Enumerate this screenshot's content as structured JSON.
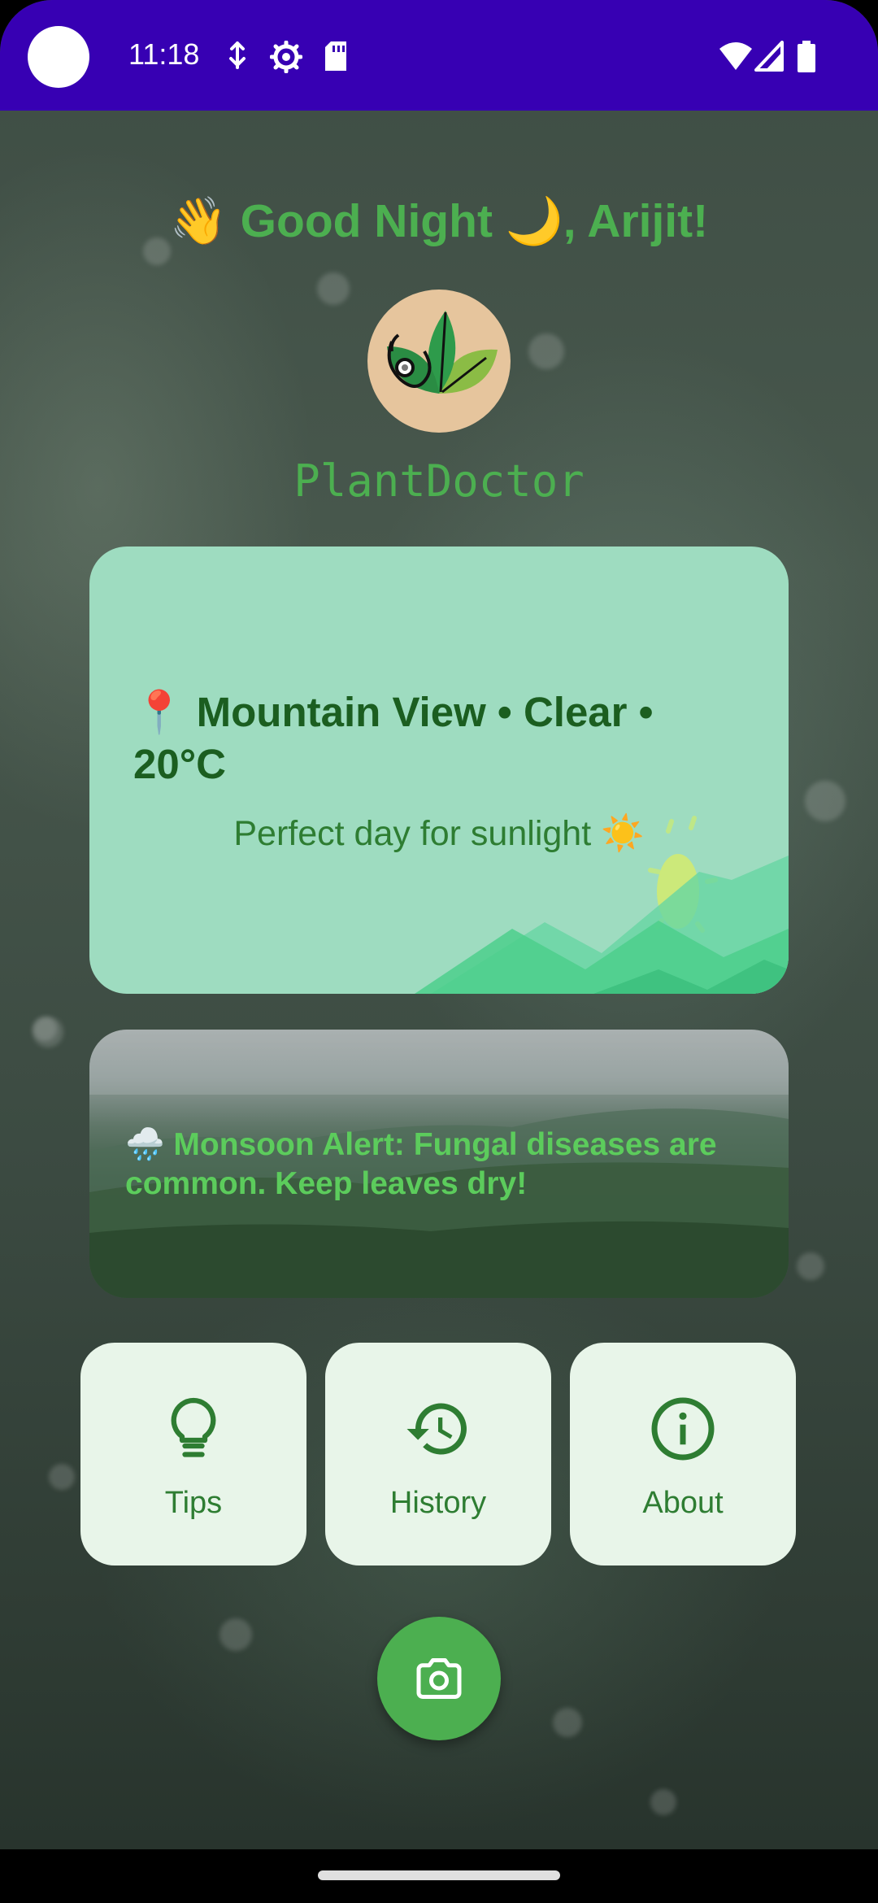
{
  "status_bar": {
    "time": "11:18",
    "left_icons": [
      "tap-icon",
      "settings-icon",
      "sd-card-icon"
    ],
    "right_icons": [
      "wifi-icon",
      "signal-icon",
      "battery-icon"
    ],
    "background": "#3700b3"
  },
  "greeting": {
    "text": "👋 Good Night 🌙, Arijit!"
  },
  "app": {
    "name": "PlantDoctor",
    "logo_icon": "plant-doctor-logo"
  },
  "weather": {
    "line": "📍 Mountain View • Clear • 20°C",
    "subtitle": "Perfect day for sunlight ☀️",
    "card_color": "#9edcc0"
  },
  "alert": {
    "text": "🌧️ Monsoon Alert: Fungal diseases are common. Keep leaves dry!"
  },
  "nav": [
    {
      "label": "Tips",
      "icon": "lightbulb-icon"
    },
    {
      "label": "History",
      "icon": "history-icon"
    },
    {
      "label": "About",
      "icon": "info-icon"
    }
  ],
  "fab": {
    "icon": "camera-icon"
  },
  "colors": {
    "accent": "#4caf50",
    "dark_green": "#2e7d32",
    "nav_card": "#e8f5e9"
  }
}
